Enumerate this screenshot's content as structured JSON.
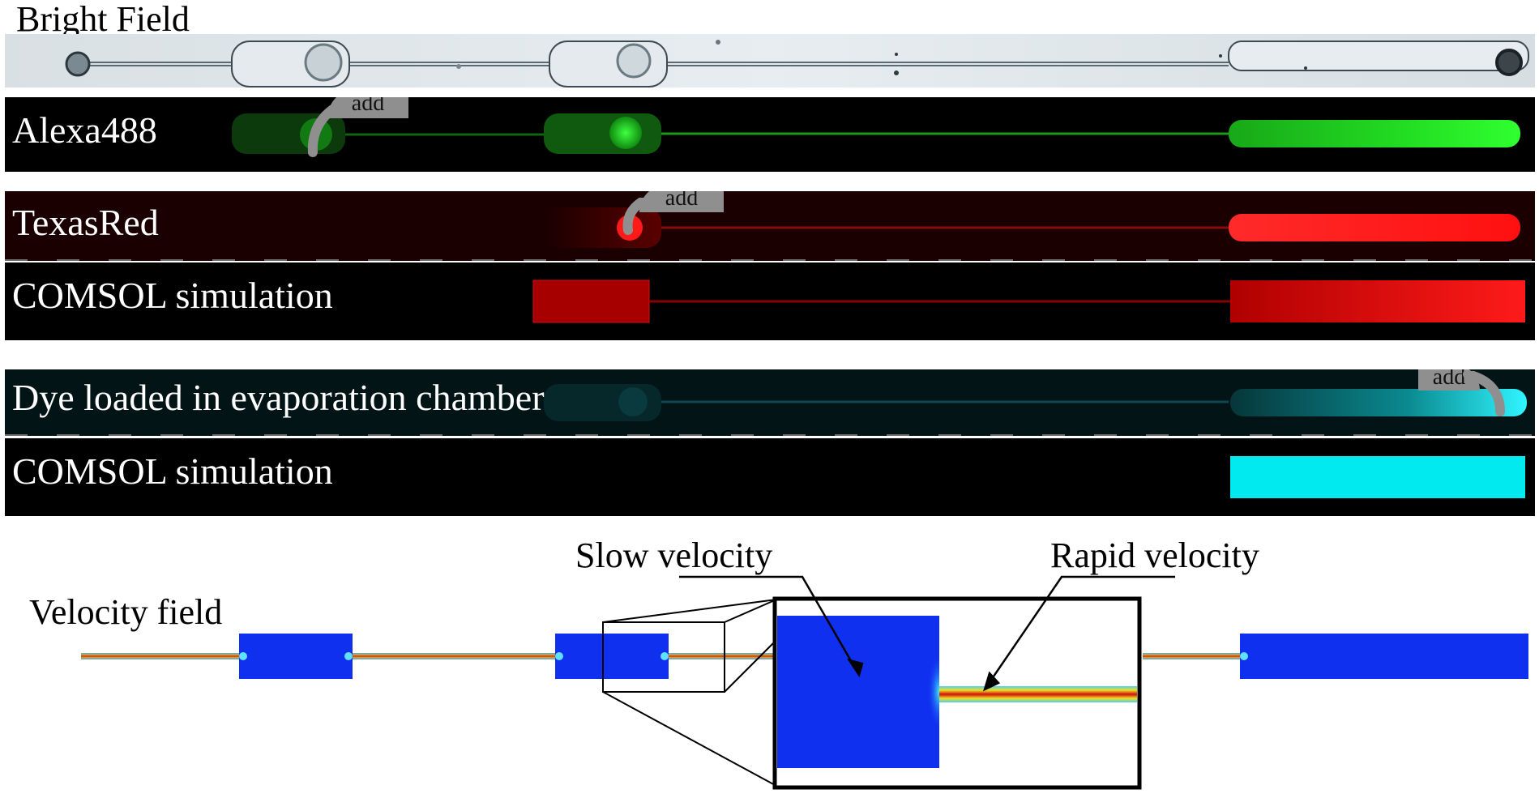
{
  "panels": {
    "bright_field": {
      "title": "Bright Field"
    },
    "alexa": {
      "title": "Alexa488",
      "add_label": "add"
    },
    "texasred": {
      "title": "TexasRed",
      "add_label": "add"
    },
    "comsol_red": {
      "title": "COMSOL simulation"
    },
    "dye_evap": {
      "title": "Dye loaded in evaporation chamber",
      "add_label": "add"
    },
    "comsol_cyan": {
      "title": "COMSOL simulation"
    }
  },
  "velocity": {
    "title": "Velocity field",
    "slow_label": "Slow velocity",
    "rapid_label": "Rapid velocity"
  },
  "colors": {
    "green": "#22ee22",
    "red": "#ff1a1a",
    "comsol_red": "#b00000",
    "cyan": "#00eaf0",
    "velocity_blue": "#1030f0",
    "velocity_channel": "#c98a3a"
  }
}
